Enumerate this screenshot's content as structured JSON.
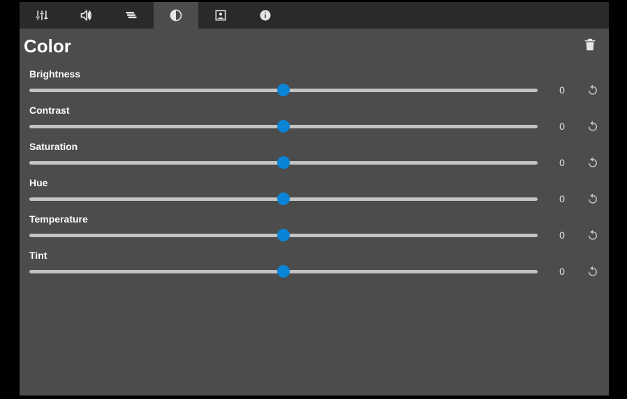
{
  "tabs": [
    {
      "name": "mixer",
      "active": false
    },
    {
      "name": "audio",
      "active": false
    },
    {
      "name": "layers",
      "active": false
    },
    {
      "name": "contrast",
      "active": true
    },
    {
      "name": "profile",
      "active": false
    },
    {
      "name": "info",
      "active": false
    }
  ],
  "header": {
    "title": "Color"
  },
  "sliders": [
    {
      "label": "Brightness",
      "value": "0",
      "position": 0.5
    },
    {
      "label": "Contrast",
      "value": "0",
      "position": 0.5
    },
    {
      "label": "Saturation",
      "value": "0",
      "position": 0.5
    },
    {
      "label": "Hue",
      "value": "0",
      "position": 0.5
    },
    {
      "label": "Temperature",
      "value": "0",
      "position": 0.5
    },
    {
      "label": "Tint",
      "value": "0",
      "position": 0.5
    }
  ],
  "colors": {
    "accent": "#0a84d6"
  }
}
